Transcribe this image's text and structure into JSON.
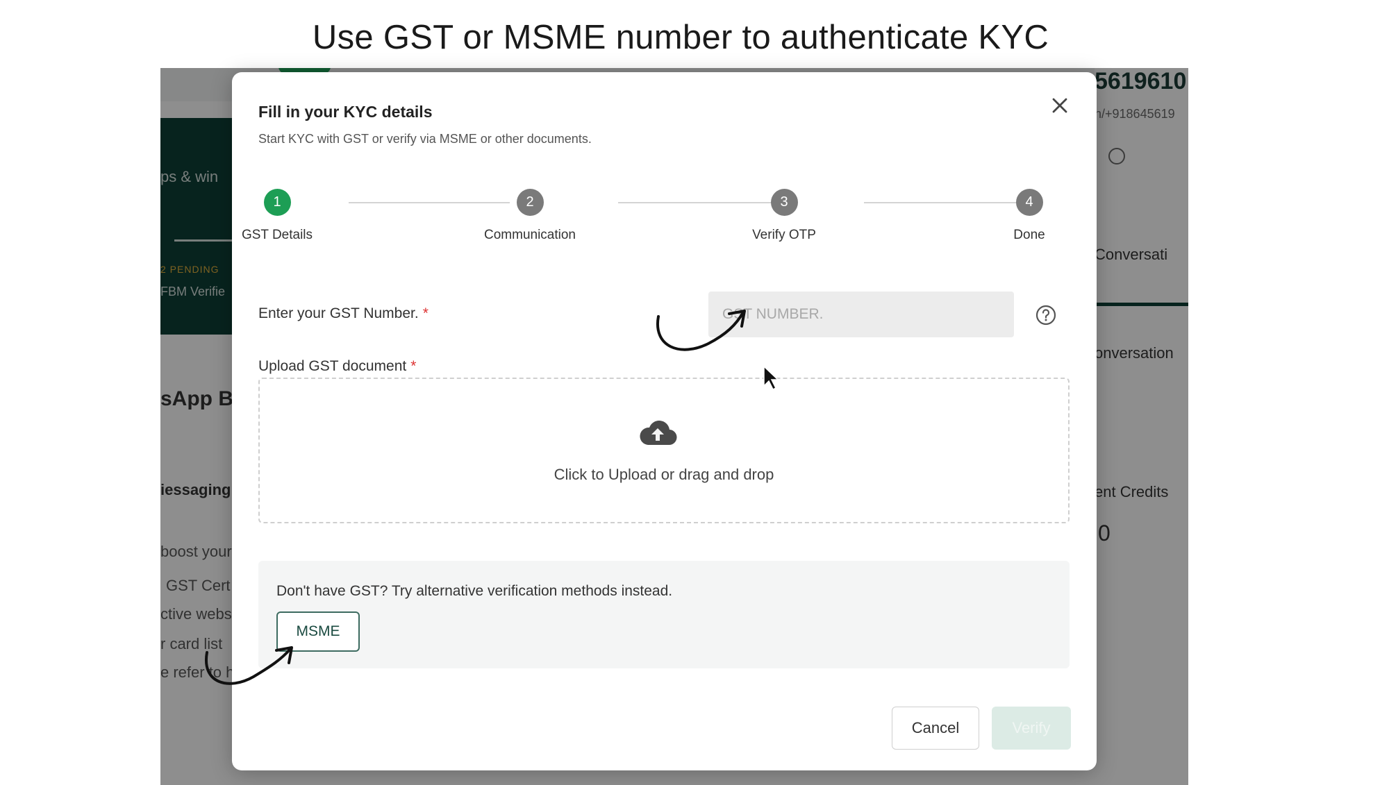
{
  "headline": "Use GST or MSME number to authenticate KYC",
  "background_app": {
    "promo_text": "ps & win",
    "pending_badge": "2  PENDING",
    "fbm_text": "FBM Verifie",
    "section_title": "sApp B",
    "messaging_title": "iessaging",
    "lines": [
      "boost your",
      "GST Cert",
      "ctive webs",
      "r card list",
      "e refer to h"
    ],
    "phone_number": "5619610",
    "phone_sub": "n/+918645619",
    "conversation_1": "Conversati",
    "conversation_2": "onversation",
    "credits_label": "ent Credits",
    "credits_value": "0"
  },
  "modal": {
    "title": "Fill in your KYC details",
    "subtitle": "Start KYC with GST or verify via MSME or other documents.",
    "close_icon": "close-icon",
    "steps": [
      {
        "number": "1",
        "label": "GST Details",
        "active": true
      },
      {
        "number": "2",
        "label": "Communication",
        "active": false
      },
      {
        "number": "3",
        "label": "Verify OTP",
        "active": false
      },
      {
        "number": "4",
        "label": "Done",
        "active": false
      }
    ],
    "gst_label": "Enter your GST Number.",
    "required_mark": "*",
    "gst_placeholder": "GST NUMBER.",
    "gst_value": "",
    "help_icon": "question-circle-icon",
    "upload_label": "Upload GST document",
    "upload_icon": "cloud-upload-icon",
    "upload_text": "Click to Upload or drag and drop",
    "alt_text": "Don't have GST? Try alternative verification methods instead.",
    "msme_button": "MSME",
    "cancel_button": "Cancel",
    "verify_button": "Verify"
  },
  "colors": {
    "accent_green": "#1d9e55",
    "step_inactive": "#7a7a7a",
    "dark_teal": "#0d3d35",
    "required_red": "#d33333"
  }
}
